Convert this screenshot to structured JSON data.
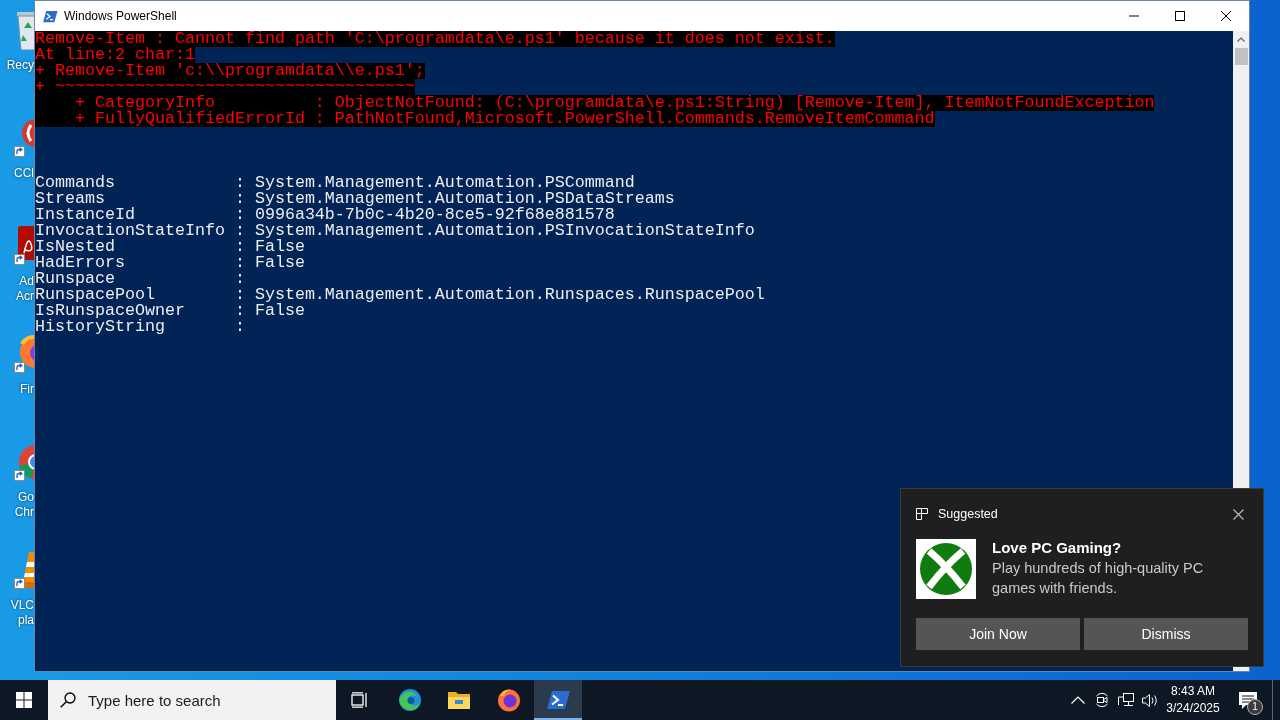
{
  "desktop_icons": [
    {
      "kind": "recycle_bin",
      "label": [
        "Recy"
      ]
    },
    {
      "kind": "ccleaner",
      "label": [
        "CCl"
      ]
    },
    {
      "kind": "acrobat",
      "label": [
        "Ad",
        "Acr"
      ]
    },
    {
      "kind": "firefox",
      "label": [
        "Fir"
      ]
    },
    {
      "kind": "chrome",
      "label": [
        "Go",
        "Chr"
      ]
    },
    {
      "kind": "vlc",
      "label": [
        "VLC",
        "pla"
      ]
    }
  ],
  "window": {
    "title": "Windows PowerShell",
    "console": {
      "error_lines": [
        "Remove-Item : Cannot find path 'C:\\programdata\\e.ps1' because it does not exist.",
        "At line:2 char:1",
        "+ Remove-Item 'c:\\\\programdata\\\\e.ps1';",
        "+ ~~~~~~~~~~~~~~~~~~~~~~~~~~~~~~~~~~~~",
        "    + CategoryInfo          : ObjectNotFound: (C:\\programdata\\e.ps1:String) [Remove-Item], ItemNotFoundException",
        "    + FullyQualifiedErrorId : PathNotFound,Microsoft.PowerShell.Commands.RemoveItemCommand"
      ],
      "output_lines": [
        "Commands            : System.Management.Automation.PSCommand",
        "Streams             : System.Management.Automation.PSDataStreams",
        "InstanceId          : 0996a34b-7b0c-4b20-8ce5-92f68e881578",
        "InvocationStateInfo : System.Management.Automation.PSInvocationStateInfo",
        "IsNested            : False",
        "HadErrors           : False",
        "Runspace            :",
        "RunspacePool        : System.Management.Automation.Runspaces.RunspacePool",
        "IsRunspaceOwner     : False",
        "HistoryString       :"
      ]
    }
  },
  "notification": {
    "header": "Suggested",
    "title": "Love PC Gaming?",
    "body": "Play hundreds of high-quality PC games with friends.",
    "buttons": [
      "Join Now",
      "Dismiss"
    ]
  },
  "taskbar": {
    "search": {
      "placeholder": "Type here to search"
    },
    "apps": [
      {
        "kind": "task_view",
        "selected": false
      },
      {
        "kind": "edge",
        "selected": false
      },
      {
        "kind": "explorer",
        "selected": false
      },
      {
        "kind": "firefox",
        "selected": false
      },
      {
        "kind": "powershell",
        "selected": true
      }
    ],
    "clock": {
      "time": "8:43 AM",
      "date": "3/24/2025"
    },
    "notification_count": "1"
  }
}
